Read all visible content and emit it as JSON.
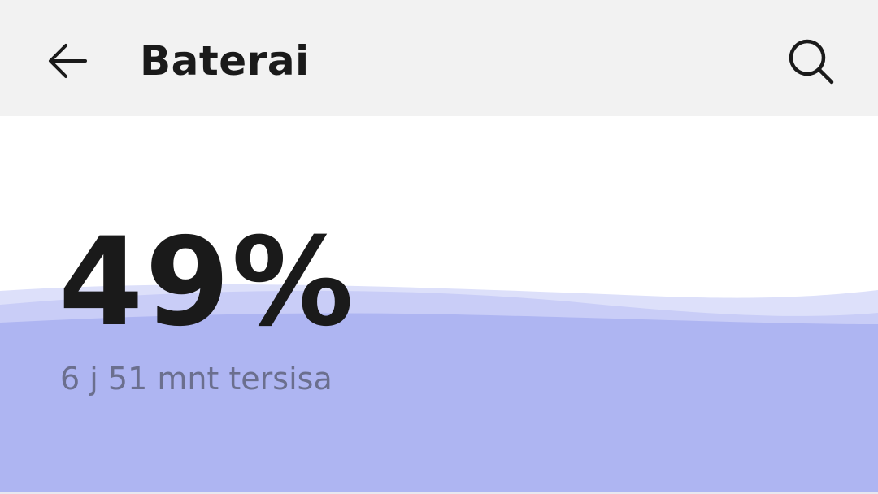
{
  "header": {
    "title": "Baterai",
    "back_icon": "arrow-left-icon",
    "search_icon": "search-icon"
  },
  "battery": {
    "percent_label": "49%",
    "level_percent": 49,
    "time_remaining": "6 j 51 mnt tersisa"
  },
  "colors": {
    "header_background": "#f2f2f2",
    "wave_fill": "#aeb5f2",
    "wave_light": "#dde0fa",
    "text_primary": "#1a1a1a",
    "text_secondary": "#6b6f8e"
  }
}
